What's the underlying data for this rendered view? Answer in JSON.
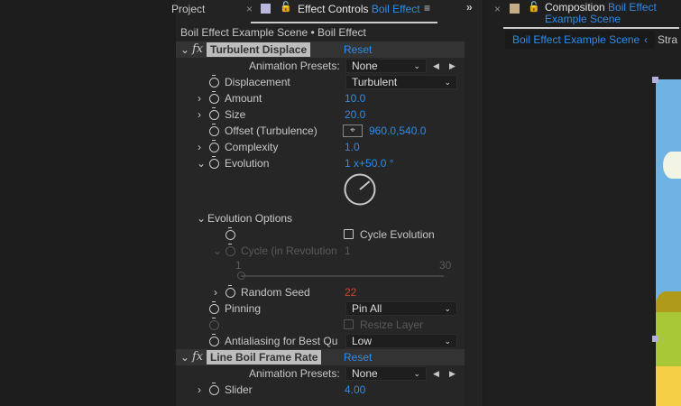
{
  "project_panel": {
    "tab_label": "Project"
  },
  "effect_controls": {
    "tab_label": "Effect Controls",
    "tab_layer": "Boil Effect",
    "breadcrumb": "Boil Effect Example Scene • Boil Effect",
    "effects": [
      {
        "name": "Turbulent Displace",
        "reset": "Reset",
        "presets_label": "Animation Presets:",
        "preset_value": "None",
        "params": {
          "displacement": {
            "label": "Displacement",
            "value": "Turbulent"
          },
          "amount": {
            "label": "Amount",
            "value": "10.0"
          },
          "size": {
            "label": "Size",
            "value": "20.0"
          },
          "offset": {
            "label": "Offset (Turbulence)",
            "value": "960.0,540.0"
          },
          "complexity": {
            "label": "Complexity",
            "value": "1.0"
          },
          "evolution": {
            "label": "Evolution",
            "value": "1 x+50.0 °",
            "angle_deg": 50
          },
          "evolution_options": {
            "label": "Evolution Options"
          },
          "cycle_evolution": {
            "label": "Cycle Evolution",
            "checked": false
          },
          "cycle": {
            "label": "Cycle (in Revolution",
            "value": "1",
            "slider_min": "1",
            "slider_max": "30"
          },
          "random_seed": {
            "label": "Random Seed",
            "value": "22"
          },
          "pinning": {
            "label": "Pinning",
            "value": "Pin All"
          },
          "resize_layer": {
            "label": "Resize Layer",
            "checked": false
          },
          "antialiasing": {
            "label": "Antialiasing for Best Qu",
            "value": "Low"
          }
        }
      },
      {
        "name": "Line Boil Frame Rate",
        "reset": "Reset",
        "presets_label": "Animation Presets:",
        "preset_value": "None",
        "params": {
          "slider": {
            "label": "Slider",
            "value": "4.00"
          }
        }
      }
    ]
  },
  "composition": {
    "tab_label": "Composition",
    "tab_name": "Boil Effect Example Scene",
    "breadcrumb_active": "Boil Effect Example Scene",
    "breadcrumb_next": "Stra"
  },
  "colors": {
    "accent": "#2d8ceb",
    "seed_value": "#d2412f",
    "sky": "#6fb2e4",
    "grass": "#a8c838"
  }
}
